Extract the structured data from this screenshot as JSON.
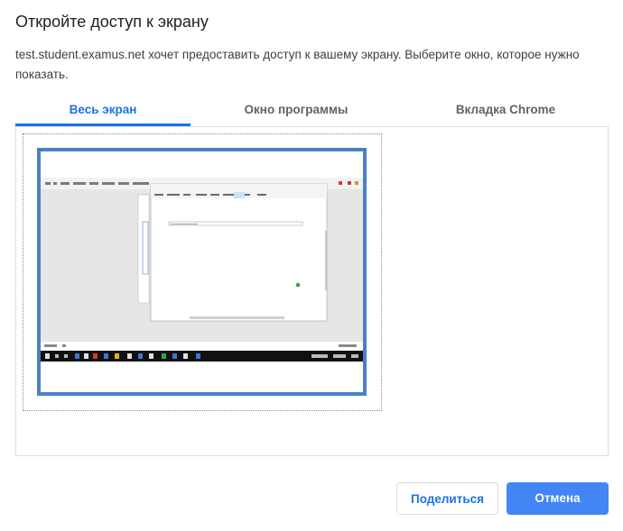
{
  "dialog": {
    "title": "Откройте доступ к экрану",
    "description": "test.student.examus.net хочет предоставить доступ к вашему экрану. Выберите окно, которое нужно показать."
  },
  "tabs": [
    {
      "label": "Весь экран",
      "active": true
    },
    {
      "label": "Окно программы",
      "active": false
    },
    {
      "label": "Вкладка Chrome",
      "active": false
    }
  ],
  "screen_preview": {
    "selected": true,
    "accent_color": "#4a80c8"
  },
  "buttons": {
    "share_label": "Поделиться",
    "cancel_label": "Отмена"
  },
  "colors": {
    "accent": "#1a73e8",
    "primary_button": "#4285f4"
  }
}
